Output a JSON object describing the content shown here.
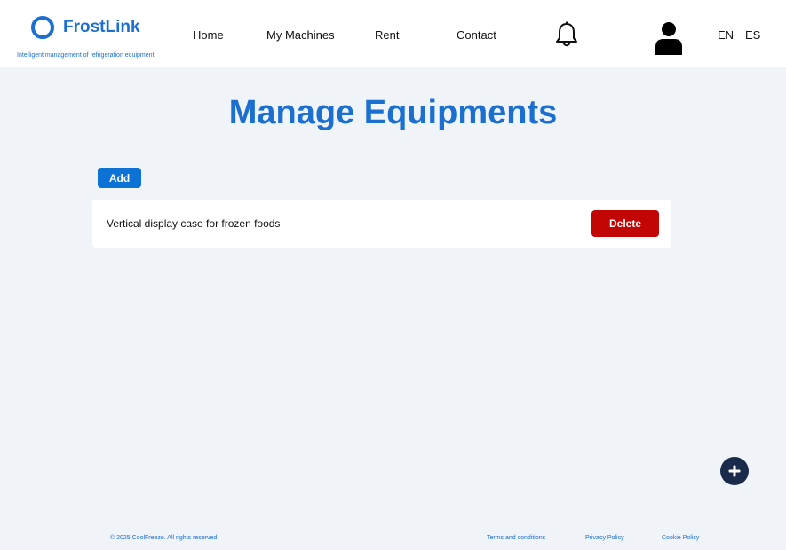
{
  "brand": {
    "name": "FrostLink",
    "tagline": "Intelligent management of refrigeration equipment",
    "accent_color": "#1a6fd1"
  },
  "nav": {
    "items": [
      {
        "label": "Home"
      },
      {
        "label": "My Machines"
      },
      {
        "label": "Rent"
      },
      {
        "label": "Contact"
      }
    ],
    "notification_icon": "bell-icon",
    "profile_icon": "user-icon"
  },
  "languages": [
    "EN",
    "ES"
  ],
  "main": {
    "title": "Manage Equipments",
    "add_label": "Add",
    "equipment": [
      {
        "name": "Vertical display case for frozen foods",
        "delete_label": "Delete"
      }
    ],
    "delete_color": "#c20505"
  },
  "fab": {
    "icon": "plus-icon"
  },
  "footer": {
    "copyright": "© 2025 CoolFreeze. All rights reserved.",
    "links": [
      {
        "label": "Terms and conditions"
      },
      {
        "label": "Privacy Policy"
      },
      {
        "label": "Cookie Policy"
      }
    ]
  }
}
